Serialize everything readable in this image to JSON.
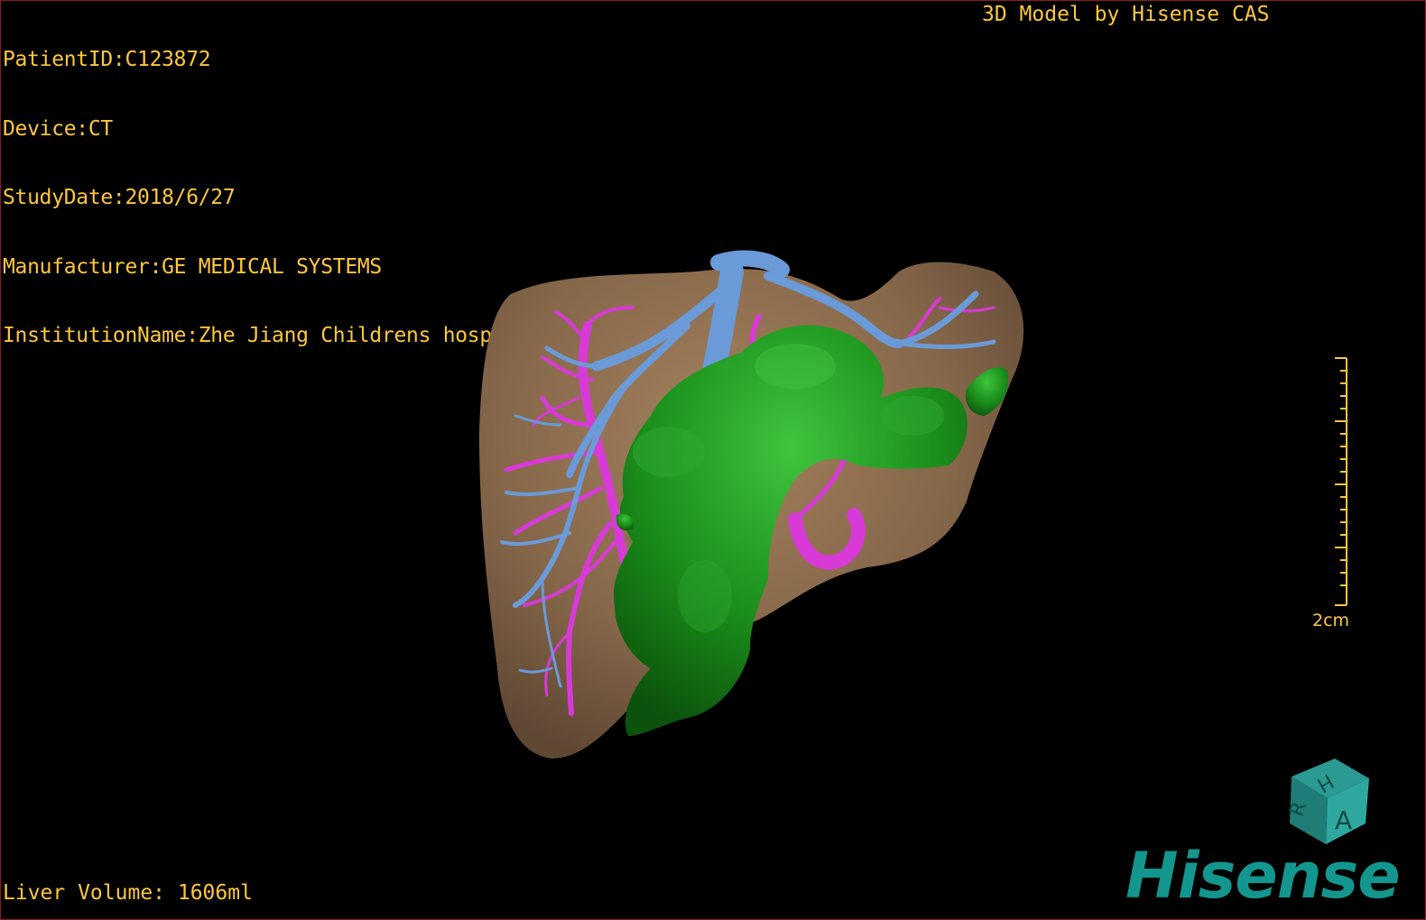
{
  "overlay": {
    "patient_id": "PatientID:C123872",
    "device": "Device:CT",
    "study_date": "StudyDate:2018/6/27",
    "manufacturer": "Manufacturer:GE MEDICAL SYSTEMS",
    "institution": "InstitutionName:Zhe Jiang Childrens hospital",
    "model_credit": "3D Model by Hisense CAS",
    "liver_volume": "Liver Volume: 1606ml"
  },
  "scale_bar": {
    "label": "2cm"
  },
  "orientation_cube": {
    "faces": [
      "H",
      "R",
      "A"
    ]
  },
  "logo": {
    "text": "Hisense"
  },
  "colors": {
    "text": "#ffc83c",
    "background": "#000000",
    "liver": "#8a6a4a",
    "tumor": "#1a8a1a",
    "hepatic_vein": "#6a9ad8",
    "portal_vein": "#d83ad8",
    "brand": "#13968e"
  }
}
